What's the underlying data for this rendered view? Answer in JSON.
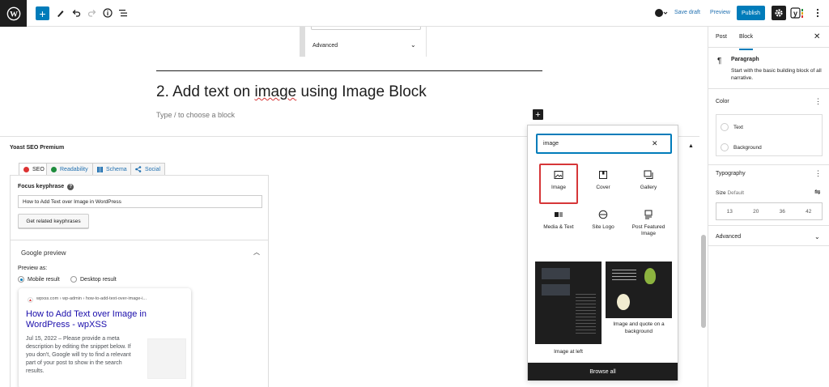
{
  "toolbar": {
    "logo": "wordpress-icon",
    "add": "+",
    "save_draft": "Save draft",
    "preview": "Preview",
    "publish": "Publish",
    "yoast_badge": "Y"
  },
  "editor": {
    "advanced_label": "Advanced",
    "heading_before": "2. Add text on ",
    "heading_squiggly": "image",
    "heading_after": " using Image Block",
    "placeholder": "Type / to choose a block",
    "plus": "+"
  },
  "yoast": {
    "title": "Yoast SEO Premium",
    "tabs": [
      {
        "label": "SEO",
        "icon": "sad-face-icon",
        "color": "#dc3232"
      },
      {
        "label": "Readability",
        "icon": "smile-face-icon",
        "color": "#1e8c3d"
      },
      {
        "label": "Schema",
        "icon": "grid-icon",
        "color": "#2271b1"
      },
      {
        "label": "Social",
        "icon": "share-icon",
        "color": "#2271b1"
      }
    ],
    "focus_label": "Focus keyphrase",
    "focus_value": "How to Add Text over Image in WordPress",
    "related_button": "Get related keyphrases",
    "google_preview": "Google preview",
    "preview_as": "Preview as:",
    "mobile_result": "Mobile result",
    "desktop_result": "Desktop result",
    "serp": {
      "url": "wpxss.com › wp-admin › how-to-add-text-over-image-i...",
      "title": "How to Add Text over Image in WordPress - wpXSS",
      "date": "Jul 15, 2022",
      "description": "Please provide a meta description by editing the snippet below. If you don't, Google will try to find a relevant part of your post to show in the search results."
    }
  },
  "inserter": {
    "search_value": "image",
    "blocks": [
      {
        "label": "Image",
        "icon": "image-icon"
      },
      {
        "label": "Cover",
        "icon": "cover-icon"
      },
      {
        "label": "Gallery",
        "icon": "gallery-icon"
      },
      {
        "label": "Media & Text",
        "icon": "media-text-icon"
      },
      {
        "label": "Site Logo",
        "icon": "site-logo-icon"
      },
      {
        "label": "Post Featured Image",
        "icon": "post-featured-image-icon"
      }
    ],
    "pattern_a": "Image at left",
    "pattern_b": "Image and quote on a background",
    "browse_all": "Browse all"
  },
  "sidebar": {
    "tab_post": "Post",
    "tab_block": "Block",
    "block_name": "Paragraph",
    "block_desc": "Start with the basic building block of all narrative.",
    "color_heading": "Color",
    "color_text": "Text",
    "color_background": "Background",
    "typography_heading": "Typography",
    "size_label": "Size",
    "size_default": "Default",
    "sizes": [
      "13",
      "20",
      "36",
      "42"
    ],
    "advanced": "Advanced"
  },
  "colors": {
    "accent": "#007cba",
    "dark": "#1e1e1e",
    "highlight": "#d63638"
  }
}
